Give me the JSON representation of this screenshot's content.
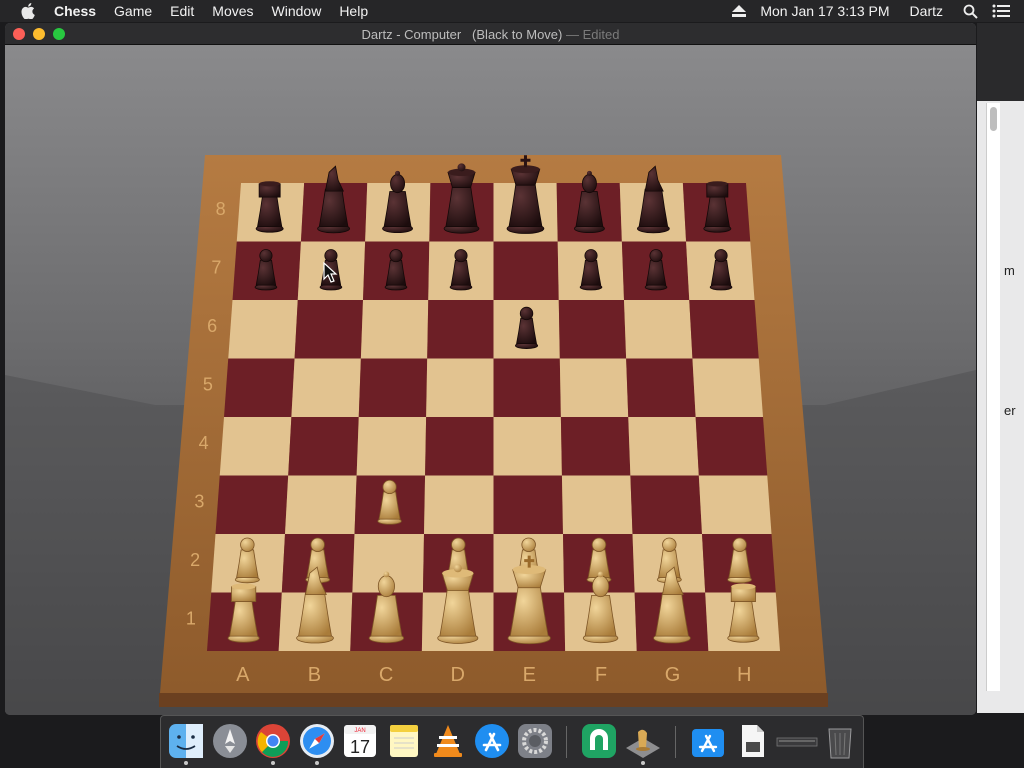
{
  "menubar": {
    "app_name": "Chess",
    "menus": [
      "Game",
      "Edit",
      "Moves",
      "Window",
      "Help"
    ],
    "clock": "Mon Jan 17  3:13 PM",
    "user": "Dartz"
  },
  "window": {
    "title": "Dartz - Computer   (Black to Move)",
    "edited": " — Edited"
  },
  "board": {
    "ranks": [
      "8",
      "7",
      "6",
      "5",
      "4",
      "3",
      "2",
      "1"
    ],
    "files": [
      "A",
      "B",
      "C",
      "D",
      "E",
      "F",
      "G",
      "H"
    ]
  },
  "side_panel": {
    "text_1": "m",
    "text_2": "er"
  },
  "dock": {
    "items": [
      "finder-icon",
      "launchpad-icon",
      "chrome-icon",
      "safari-icon",
      "calendar-icon",
      "notes-icon",
      "vlc-icon",
      "app-store-icon",
      "system-preferences-icon",
      "sourcetree-icon",
      "chess-icon",
      "app-store-downloads-icon",
      "document-icon",
      "minimized-window-icon",
      "trash-icon"
    ],
    "calendar_month": "JAN",
    "calendar_day": "17"
  },
  "colors": {
    "dark_square": "#6d1f26",
    "light_square": "#e2c390",
    "board_frame": "#9a6533",
    "black_piece": "#2a1314",
    "white_piece": "#c49b55"
  }
}
